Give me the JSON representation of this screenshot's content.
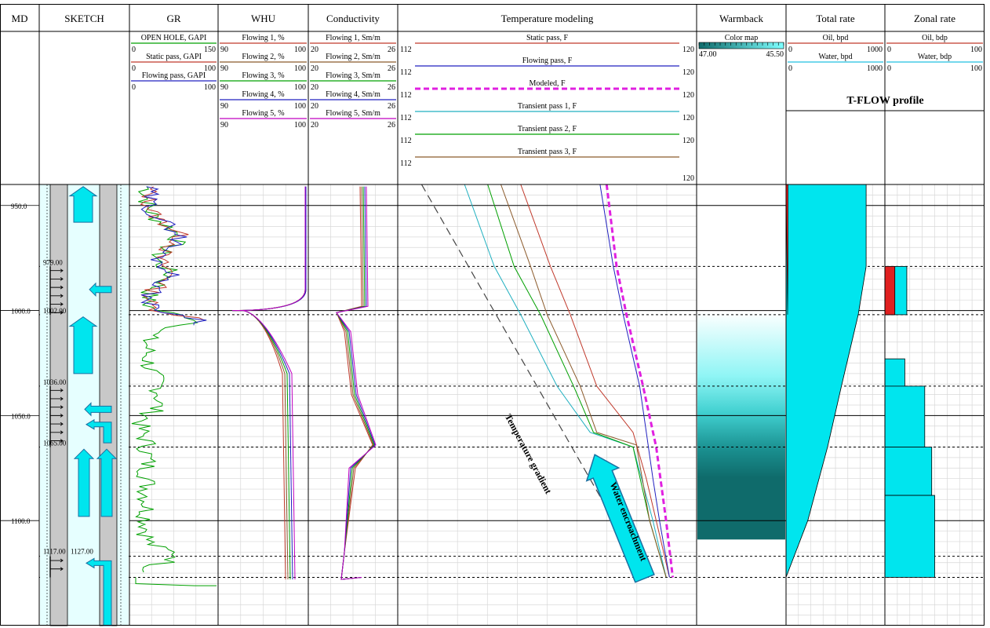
{
  "columns": [
    {
      "key": "md",
      "title": "MD"
    },
    {
      "key": "sketch",
      "title": "SKETCH"
    },
    {
      "key": "gr",
      "title": "GR"
    },
    {
      "key": "whu",
      "title": "WHU"
    },
    {
      "key": "cond",
      "title": "Conductivity"
    },
    {
      "key": "temp",
      "title": "Temperature modeling"
    },
    {
      "key": "warm",
      "title": "Warmback"
    },
    {
      "key": "total",
      "title": "Total rate"
    },
    {
      "key": "zonal",
      "title": "Zonal rate"
    }
  ],
  "legends": {
    "gr": [
      {
        "name": "OPEN HOLE, GAPI",
        "min": "0",
        "max": "150",
        "color": "#00a000"
      },
      {
        "name": "Static pass, GAPI",
        "min": "0",
        "max": "100",
        "color": "#c0392b"
      },
      {
        "name": "Flowing pass, GAPI",
        "min": "0",
        "max": "100",
        "color": "#2020c0"
      }
    ],
    "whu": [
      {
        "name": "Flowing 1, %",
        "min": "90",
        "max": "100",
        "color": "#c0392b"
      },
      {
        "name": "Flowing 2, %",
        "min": "90",
        "max": "100",
        "color": "#8b5a2b"
      },
      {
        "name": "Flowing 3, %",
        "min": "90",
        "max": "100",
        "color": "#00a000"
      },
      {
        "name": "Flowing 4, %",
        "min": "90",
        "max": "100",
        "color": "#2020c0"
      },
      {
        "name": "Flowing 5, %",
        "min": "90",
        "max": "100",
        "color": "#c000c0"
      }
    ],
    "cond": [
      {
        "name": "Flowing 1, Sm/m",
        "min": "20",
        "max": "26",
        "color": "#c0392b"
      },
      {
        "name": "Flowing 2, Sm/m",
        "min": "20",
        "max": "26",
        "color": "#8b5a2b"
      },
      {
        "name": "Flowing 3, Sm/m",
        "min": "20",
        "max": "26",
        "color": "#00a000"
      },
      {
        "name": "Flowing 4, Sm/m",
        "min": "20",
        "max": "26",
        "color": "#2020c0"
      },
      {
        "name": "Flowing 5, Sm/m",
        "min": "20",
        "max": "26",
        "color": "#c000c0"
      }
    ],
    "temp": [
      {
        "name": "Static pass, F",
        "min": "112",
        "max": "120",
        "color": "#c0392b",
        "dash": false
      },
      {
        "name": "Flowing pass, F",
        "min": "112",
        "max": "120",
        "color": "#2020c0",
        "dash": false
      },
      {
        "name": "Modeled, F",
        "min": "112",
        "max": "120",
        "color": "#e020e0",
        "dash": true
      },
      {
        "name": "Transient pass 1, F",
        "min": "112",
        "max": "120",
        "color": "#20b0c0",
        "dash": false
      },
      {
        "name": "Transient pass 2, F",
        "min": "112",
        "max": "120",
        "color": "#00a000",
        "dash": false
      },
      {
        "name": "Transient pass 3, F",
        "min": "112",
        "max": "",
        "color": "#8b5a2b",
        "dash": false
      }
    ],
    "temp_extra_max": "120",
    "warm": {
      "name": "Color map",
      "min": "47.00",
      "max": "45.50"
    },
    "total": [
      {
        "name": "Oil, bpd",
        "min": "0",
        "max": "1000",
        "color": "#c0392b"
      },
      {
        "name": "Water, bpd",
        "min": "0",
        "max": "1000",
        "color": "#20c0e0"
      }
    ],
    "zonal": [
      {
        "name": "Oil, bdp",
        "min": "0",
        "max": "100",
        "color": "#c0392b"
      },
      {
        "name": "Water, bdp",
        "min": "0",
        "max": "100",
        "color": "#20c0e0"
      }
    ],
    "tflow_title": "T-FLOW profile"
  },
  "depth_labels": [
    "950.0",
    "1000.0",
    "1050.0",
    "1100.0"
  ],
  "sketch_labels": {
    "z1": "979.00",
    "z2": "1002.00",
    "z3": "1036.00",
    "z4": "1065.00",
    "z5a": "1117.00",
    "z5b": "1127.00"
  },
  "annotations": {
    "gradient": "Temperature gradient",
    "water": "Water encroachment"
  },
  "colors": {
    "cyan": "#00e5ee",
    "red": "#e02020",
    "teal_dark": "#0f6b6b",
    "grid": "#d8d8d8"
  },
  "chart_data": {
    "type": "well-log",
    "depth_axis": {
      "min": 940,
      "max": 1150,
      "major": [
        950,
        1000,
        1050,
        1100
      ]
    },
    "zone_boundaries": [
      979,
      1002,
      1036,
      1065,
      1117,
      1127
    ],
    "total_rate": {
      "oil_bpd_top": 20,
      "water_bpd": [
        [
          940,
          810
        ],
        [
          979,
          810
        ],
        [
          1002,
          730
        ],
        [
          1036,
          560
        ],
        [
          1065,
          420
        ],
        [
          1100,
          220
        ],
        [
          1127,
          0
        ]
      ]
    },
    "zonal_rate": {
      "oil": [
        [
          979,
          1002,
          10
        ]
      ],
      "water": [
        [
          979,
          1002,
          22
        ],
        [
          1023,
          1036,
          20
        ],
        [
          1036,
          1065,
          40
        ],
        [
          1065,
          1088,
          47
        ],
        [
          1088,
          1127,
          50
        ]
      ]
    },
    "temperature": {
      "x_range": [
        112,
        120
      ],
      "static_pass": [
        [
          940,
          115.2
        ],
        [
          979,
          116.1
        ],
        [
          1002,
          116.7
        ],
        [
          1036,
          117.5
        ],
        [
          1058,
          118.6
        ],
        [
          1080,
          119.0
        ],
        [
          1100,
          119.3
        ],
        [
          1127,
          119.7
        ]
      ],
      "flowing_pass": [
        [
          940,
          117.6
        ],
        [
          979,
          118.0
        ],
        [
          1002,
          118.3
        ],
        [
          1036,
          118.8
        ],
        [
          1058,
          119.0
        ],
        [
          1080,
          119.2
        ],
        [
          1100,
          119.4
        ],
        [
          1127,
          119.7
        ]
      ],
      "modeled": [
        [
          940,
          117.8
        ],
        [
          979,
          118.1
        ],
        [
          1002,
          118.4
        ],
        [
          1036,
          118.9
        ],
        [
          1065,
          119.3
        ],
        [
          1100,
          119.6
        ],
        [
          1127,
          119.8
        ]
      ],
      "transient_1": [
        [
          940,
          113.5
        ],
        [
          979,
          114.4
        ],
        [
          1002,
          115.2
        ],
        [
          1036,
          116.3
        ],
        [
          1058,
          117.3
        ],
        [
          1065,
          118.6
        ],
        [
          1100,
          119.2
        ],
        [
          1127,
          119.6
        ]
      ],
      "transient_2": [
        [
          940,
          114.2
        ],
        [
          979,
          115.0
        ],
        [
          1002,
          115.8
        ],
        [
          1036,
          116.8
        ],
        [
          1058,
          117.4
        ],
        [
          1065,
          118.6
        ],
        [
          1100,
          119.1
        ],
        [
          1127,
          119.6
        ]
      ],
      "transient_3": [
        [
          940,
          114.6
        ],
        [
          979,
          115.5
        ],
        [
          1002,
          116.0
        ],
        [
          1036,
          117.0
        ],
        [
          1058,
          117.5
        ],
        [
          1064,
          118.7
        ],
        [
          1100,
          119.1
        ],
        [
          1127,
          119.6
        ]
      ],
      "gradient": [
        [
          940,
          112.2
        ],
        [
          1127,
          119.0
        ]
      ]
    }
  }
}
